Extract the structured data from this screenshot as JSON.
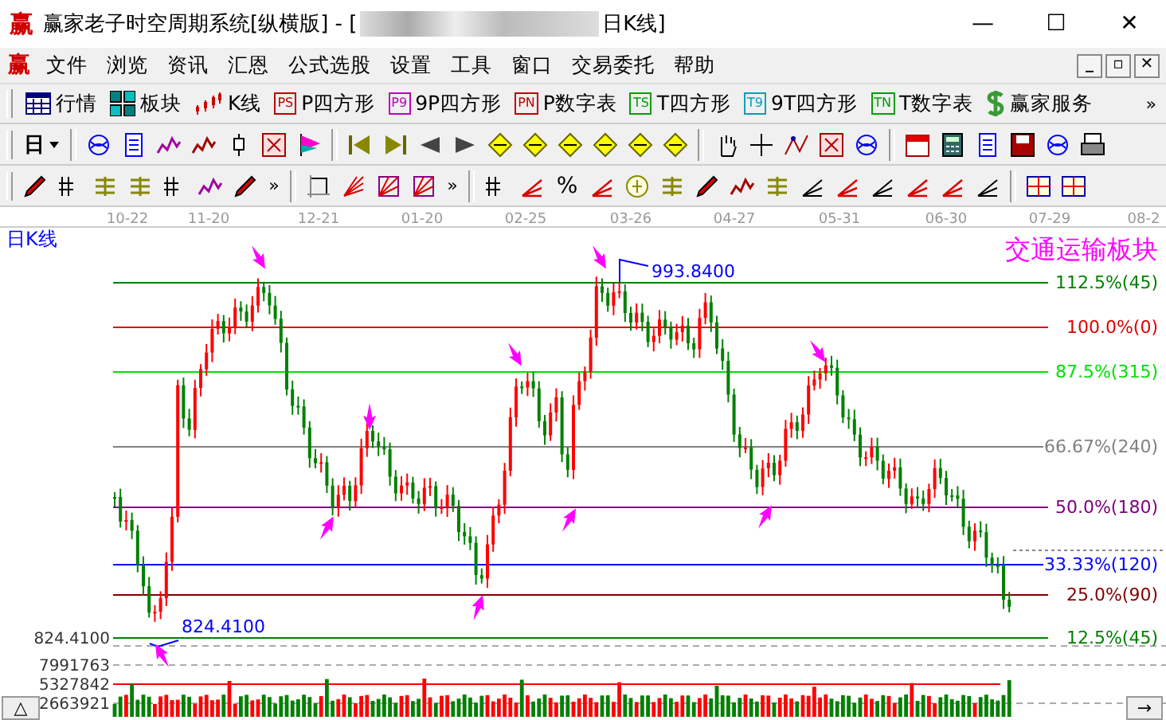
{
  "window": {
    "logo": "赢",
    "title": "赢家老子时空周期系统[纵横版] - [",
    "title_tail": "日K线]",
    "buttons": [
      "—",
      "☐",
      "✕"
    ]
  },
  "menu": {
    "logo": "赢",
    "items": [
      "文件",
      "浏览",
      "资讯",
      "汇恩",
      "公式选股",
      "设置",
      "工具",
      "窗口",
      "交易委托",
      "帮助"
    ],
    "mdi_buttons": [
      "_",
      "▫",
      "✕"
    ]
  },
  "toolbar_main": {
    "items": [
      {
        "label": "行情",
        "kind": "grid"
      },
      {
        "label": "板块",
        "kind": "blocks"
      },
      {
        "label": "K线",
        "kind": "candles"
      },
      {
        "label": "P四方形",
        "kind": "badge",
        "badge": "PS",
        "color": "#c00000"
      },
      {
        "label": "9P四方形",
        "kind": "badge",
        "badge": "P9",
        "color": "#c000c0"
      },
      {
        "label": "P数字表",
        "kind": "badge",
        "badge": "PN",
        "color": "#c00000"
      },
      {
        "label": "T四方形",
        "kind": "badge",
        "badge": "TS",
        "color": "#00a000"
      },
      {
        "label": "9T四方形",
        "kind": "badge",
        "badge": "T9",
        "color": "#00a0c0"
      },
      {
        "label": "T数字表",
        "kind": "badge",
        "badge": "TN",
        "color": "#00a000"
      },
      {
        "label": "赢家服务",
        "kind": "dollar"
      }
    ],
    "more": "»"
  },
  "toolbar_period": {
    "label": "日"
  },
  "toolbar_tools": {
    "percent": "%",
    "more": [
      "»",
      "»"
    ]
  },
  "chart": {
    "period_label": "日K线",
    "board_title": "交通运输板块",
    "dates": [
      "10-22",
      "11-20",
      "12-21",
      "01-20",
      "02-25",
      "03-26",
      "04-27",
      "05-31",
      "06-30",
      "07-29",
      "08-2"
    ],
    "levels": [
      {
        "label": "112.5%(45)",
        "color": "#007f00"
      },
      {
        "label": "100.0%(0)",
        "color": "#e00000"
      },
      {
        "label": "87.5%(315)",
        "color": "#00e000"
      },
      {
        "label": "66.67%(240)",
        "color": "#808080"
      },
      {
        "label": "50.0%(180)",
        "color": "#800080"
      },
      {
        "label": "33.33%(120)",
        "color": "#0000ff"
      },
      {
        "label": "25.0%(90)",
        "color": "#800000"
      },
      {
        "label": "12.5%(45)",
        "color": "#007f00"
      }
    ],
    "high_label": "993.8400",
    "low_label": "824.4100",
    "axis_labels": [
      "824.4100",
      "7991763",
      "5327842",
      "2663921"
    ],
    "corner_buttons": [
      "△",
      "→"
    ]
  }
}
